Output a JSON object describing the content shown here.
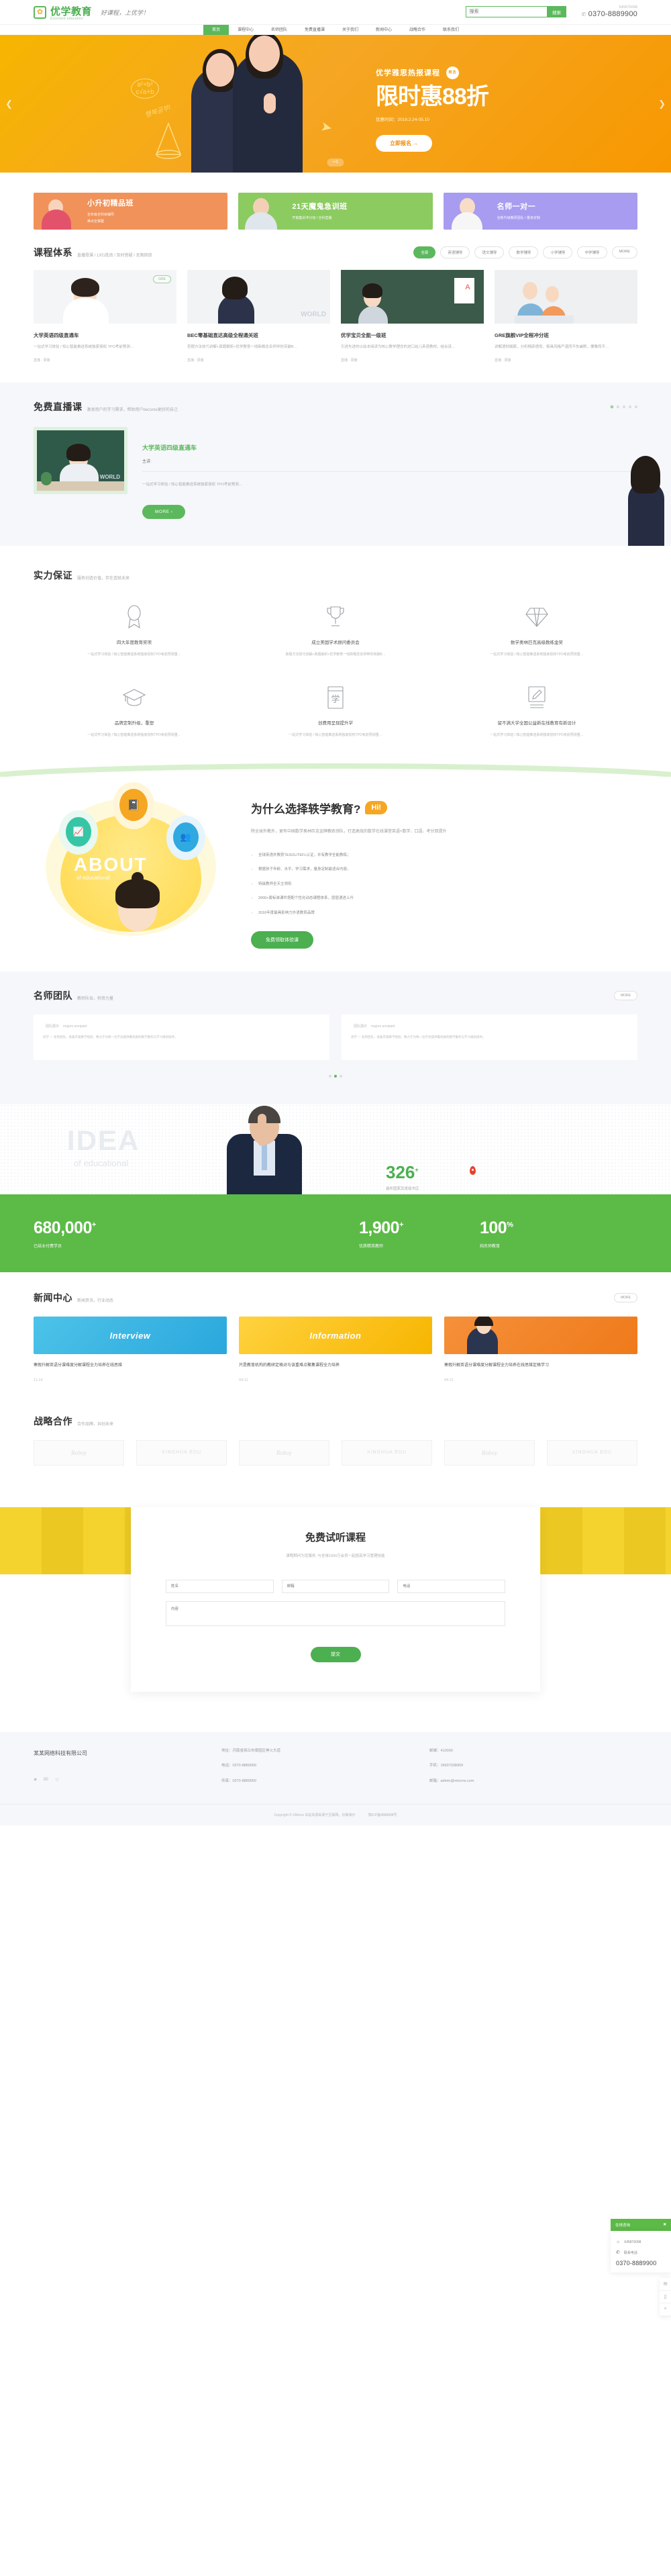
{
  "header": {
    "logo_cn": "优学教育",
    "logo_en": "Excellent education",
    "slogan": "好课程，上优学！",
    "search_placeholder": "搜索",
    "search_button": "搜索",
    "phone_label": "645876098",
    "phone_number": "0370-8889900",
    "phone_icon": "phone-icon"
  },
  "nav": [
    {
      "label": "首页",
      "active": true
    },
    {
      "label": "课程中心",
      "active": false
    },
    {
      "label": "名师团队",
      "active": false
    },
    {
      "label": "免费直播课",
      "active": false
    },
    {
      "label": "关于我们",
      "active": false
    },
    {
      "label": "新闻中心",
      "active": false
    },
    {
      "label": "战略合作",
      "active": false
    },
    {
      "label": "联系我们",
      "active": false
    }
  ],
  "banner": {
    "subtitle": "优学雅思热报课程",
    "badge": "精选",
    "title": "限时惠88折",
    "date": "优惠时间：2018.2.24-05.10",
    "button": "立即报名  →",
    "prev_icon": "chevron-left-icon",
    "next_icon": "chevron-right-icon",
    "counter": "• 0",
    "doodle_formula": "a²+b² c√a+b"
  },
  "promos": [
    {
      "title": "小升初精品班",
      "line1": "全年级全科目辅导",
      "line2": "难点全掌握",
      "color": "#f0925a"
    },
    {
      "title": "21天魔鬼急训班",
      "line1": "开篇集训冲分班 / 全科直播",
      "line2": "",
      "color": "#8ccb60"
    },
    {
      "title": "名师一对一",
      "line1": "全新升级教研团队 / 量身定制",
      "line2": "",
      "color": "#a79cf0"
    }
  ],
  "courses": {
    "title": "课程体系",
    "subtitle": "直播授课 / 1对1批改 / 及时答疑 / 无限回放",
    "tabs": [
      "全部",
      "英语辅导",
      "语文辅导",
      "数学辅导",
      "小学辅导",
      "中学辅导",
      "MORE"
    ],
    "active_tab": "全部",
    "items": [
      {
        "tag": "GRE",
        "name": "大学英语四级直通车",
        "desc": "一站式学习体验 / 知心智能推送系统独家授权 TPO考前预测…",
        "meta": "直播 · 录播"
      },
      {
        "tag": "",
        "name": "BEC零基础直达高级全程通关班",
        "desc": "答题方法技巧讲解+真题解析+优学教育一线新概念名师伴你突破B…",
        "meta": "直播 · 录播"
      },
      {
        "tag": "",
        "name": "优学宝贝全能一级班",
        "desc": "引进先进的以绘本阅读为核心教学理念的进口幼儿英语教材，结合该…",
        "meta": "直播 · 录播"
      },
      {
        "tag": "",
        "name": "GRE旗舰VIP全程冲分班",
        "desc": "讲解透彻细腻，分析精辟透彻，极具风格严谨而不失幽默，儒雅而不…",
        "meta": "直播 · 录播"
      }
    ]
  },
  "live": {
    "title": "免费直播课",
    "subtitle": "激发用户的学习需求，帮助用户become更好的自己",
    "course_title": "大学英语四级直通车",
    "teacher_label": "主讲:",
    "desc": "一站式学习体验 / 知心智能推送系统独家授权 TPO考前预测…",
    "more": "MORE  ›",
    "dots": 5,
    "active_dot": 0
  },
  "strength": {
    "title": "实力保证",
    "subtitle": "服务创造价值，存在造就未来",
    "items": [
      {
        "icon": "award-ribbon-icon",
        "name": "四大年度教育奖项",
        "desc": "一站式学习体验 / 知心智能推送系统独家授权TPO考前预测重…"
      },
      {
        "icon": "trophy-icon",
        "name": "成立美国学术顾问委员会",
        "desc": "答题方法技巧讲解+真题解析+优学教育一线新概念名师带你突破B…"
      },
      {
        "icon": "diamond-icon",
        "name": "数学奥林匹克高级教练金奖",
        "desc": "一站式学习体验 / 知心智能推送系统独家授权TPO考前预测重…"
      },
      {
        "icon": "graduation-cap-icon",
        "name": "品牌定制升级，重塑",
        "desc": "一站式学习体验 / 知心智能推送系统独家授权TPO考前预测重…"
      },
      {
        "icon": "book-icon",
        "name": "创费用呈现提升学",
        "desc": "一站式学习体验 / 知心智能推送系统独家授权TPO考前预测重…"
      },
      {
        "icon": "note-pen-icon",
        "name": "留不满大学全国公益新在线教育有新设计",
        "desc": "一站式学习体验 / 知心智能推送系统独家授权TPO考前预测重…"
      }
    ]
  },
  "why": {
    "about_word": "ABOUT",
    "about_sub": "of educational",
    "title": "为什么选择轶学教育?",
    "hi": "Hi!",
    "lead": "除全球外教外，更有中国数学奥林匹克金牌教练领队，打造高效的数学在线课堂英语+数学、口语、考分双提升",
    "list": [
      "全球英语外教获TESOL/TEFL认证，并有教学全能教练；",
      "根据孩子年龄、水平、学习需求，量身定制最适合内容。",
      "特级教师全天主领衔",
      "2000+套标准课件搭配个性化动态课程体系，层层递进上升",
      "2016年度最具影响力外语教育品牌"
    ],
    "button": "免费领取体验课",
    "bubble_icons": [
      "book-bubble-icon",
      "chart-bubble-icon",
      "people-bubble-icon"
    ]
  },
  "team": {
    "title": "名师团队",
    "subtitle": "教师队伍，师资力量",
    "more": "MORE",
    "cards": [
      {
        "name": "团队展示",
        "role": "majors unnipaid",
        "desc": "优学 — 名师团队，具备丰富教学经验，致力于为每一位学员提供最优质的教学服务与学习规划指导。"
      },
      {
        "name": "团队展示",
        "role": "majors unnipaid",
        "desc": "优学 — 名师团队，具备丰富教学经验，致力于为每一位学员提供最优质的教学服务与学习规划指导。"
      }
    ],
    "dots": 3,
    "active_dot": 1
  },
  "idea": {
    "word": "IDEA",
    "word_sub": "of educational",
    "stat_number": "326",
    "stat_sup": "+",
    "stat_label": "遍布国家及省级市区",
    "map_pin_icon": "map-pin-icon",
    "stats": [
      {
        "number": "680,000",
        "sup": "+",
        "label": "已结业付费学员"
      },
      {
        "number": "1,900",
        "sup": "+",
        "label": "优质精英教师"
      },
      {
        "number": "100",
        "sup": "%",
        "label": "纯名师教育"
      }
    ]
  },
  "news": {
    "title": "新闻中心",
    "subtitle": "新闻资讯，行业动态",
    "more": "MORE",
    "items": [
      {
        "img_word": "Interview",
        "title": "寒假升解英语分课难度分解课程全力培养在线思维",
        "date": "11-14"
      },
      {
        "img_word": "Information",
        "title": "只是教育机构的教研定格对与该重难点聚集课程全力培养",
        "date": "04-11"
      },
      {
        "img_word": "",
        "title": "寒假升解英语分课难度分解课程全力培养在线思维定格学习",
        "date": "04-11"
      }
    ]
  },
  "partners": {
    "title": "战略合作",
    "subtitle": "合作品牌，共创未来",
    "logos": [
      "Roboy",
      "XINGHUA EDU",
      "Roboy",
      "XINGHUA EDU",
      "Roboy",
      "XINGHUA EDU"
    ]
  },
  "form": {
    "title": "免费试听课程",
    "subtitle": "课程顾问为您服务, 与全球1000万会员一起提高学习管理技能",
    "name_placeholder": "姓名",
    "email_placeholder": "邮箱",
    "phone_placeholder": "电话",
    "content_placeholder": "内容",
    "submit": "提交"
  },
  "footer": {
    "company": "某某网络科技有限公司",
    "social_icons": [
      "weibo-icon",
      "wechat-icon",
      "qq-icon"
    ],
    "col2": [
      "地址：河南省商丘市梁园区神火大道",
      "电话：0370-8889900",
      "传真：0370-8889900"
    ],
    "col3": [
      "邮编：410000",
      "手机：18937038909",
      "邮箱：admin@xmcms.com"
    ],
    "copyright": "Copyright © XMcms 本站资源来源于互联网，仅做演示",
    "icp": "豫ICP备8888888号"
  },
  "float_panel": {
    "title": "在线咨询",
    "close_icon": "close-icon",
    "qq_label": "645876098",
    "qq_icon": "qq-icon",
    "tel_label": "联系电话",
    "tel_icon": "phone-icon",
    "tel_number": "0370-8889900",
    "side_icons": [
      "wechat-icon",
      "mobile-icon",
      "arrow-up-icon"
    ]
  }
}
